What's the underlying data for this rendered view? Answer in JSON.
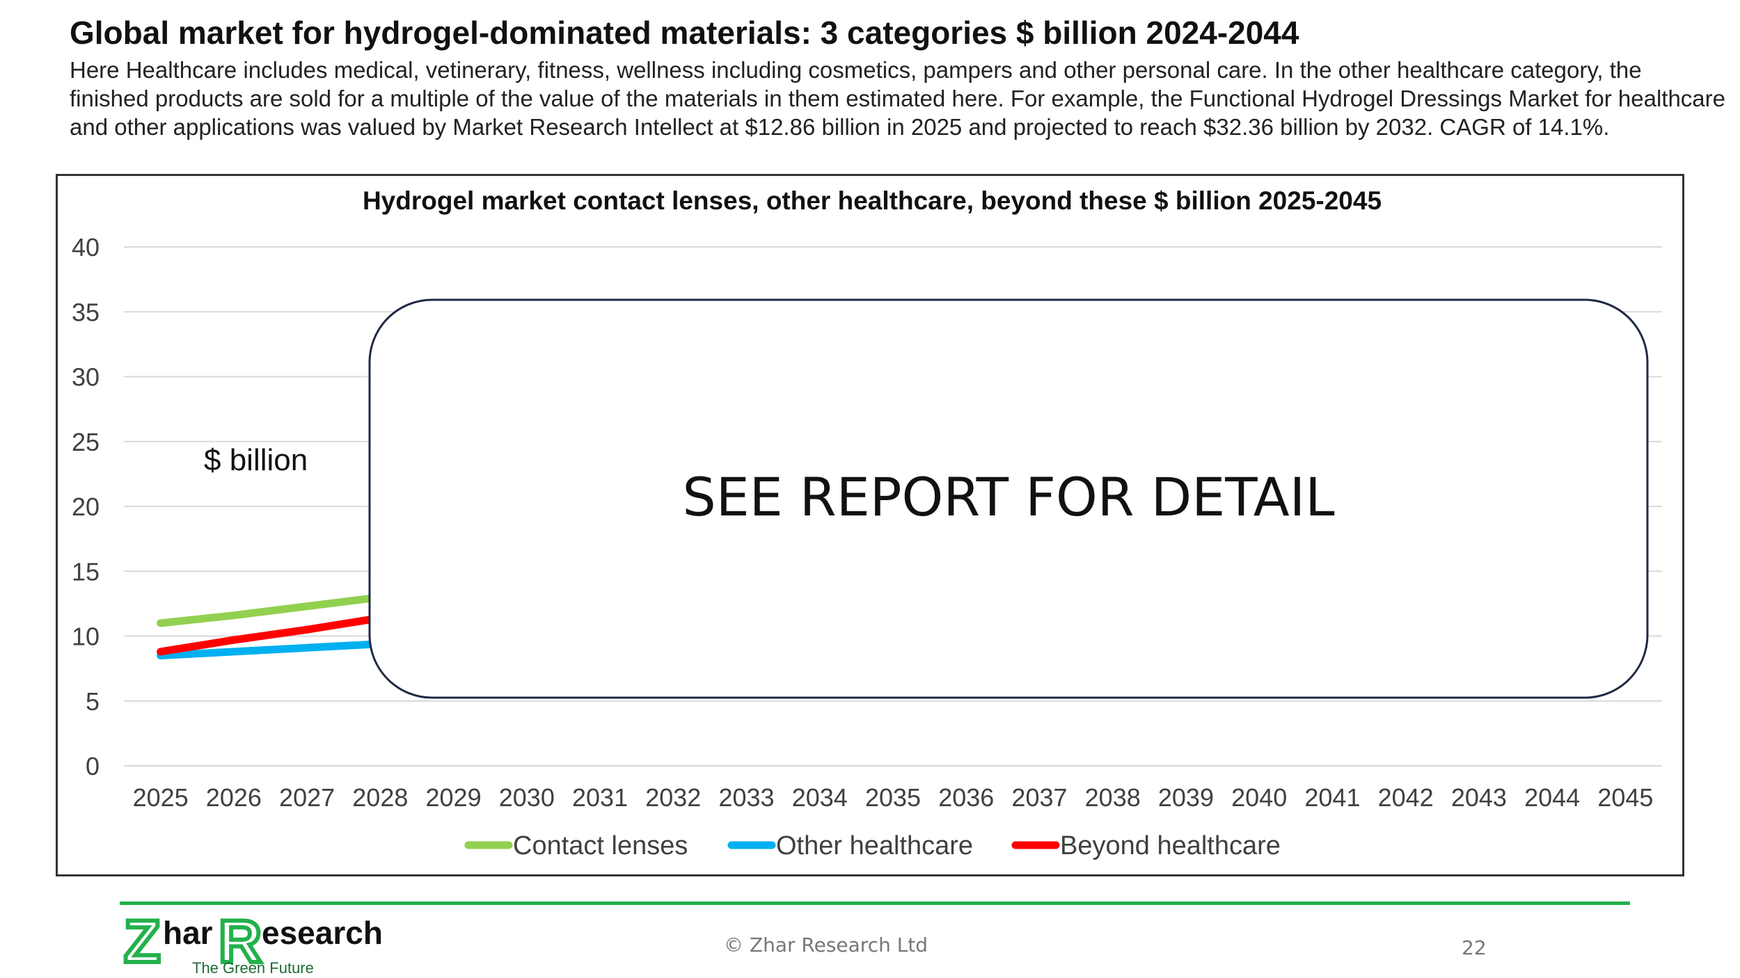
{
  "slide": {
    "title": "Global market for hydrogel-dominated materials: 3 categories $ billion 2024-2044",
    "description": "Here Healthcare includes medical, vetinerary, fitness, wellness including cosmetics, pampers and other personal care. In the other healthcare category, the finished products are sold for a multiple of the value of the materials in them estimated here. For example, the Functional Hydrogel Dressings Market  for healthcare and other applications was valued by Market Research Intellect at  $12.86 billion in 2025 and projected to reach $32.36 billion by 2032. CAGR of 14.1%."
  },
  "chart_data": {
    "type": "line",
    "title": "Hydrogel market contact lenses, other healthcare, beyond these $ billion 2025-2045",
    "ylabel": "$ billion",
    "xlabel": "",
    "ylim": [
      0,
      40
    ],
    "yticks": [
      0,
      5,
      10,
      15,
      20,
      25,
      30,
      35,
      40
    ],
    "grid": true,
    "legend": "bottom",
    "categories": [
      "2025",
      "2026",
      "2027",
      "2028",
      "2029",
      "2030",
      "2031",
      "2032",
      "2033",
      "2034",
      "2035",
      "2036",
      "2037",
      "2038",
      "2039",
      "2040",
      "2041",
      "2042",
      "2043",
      "2044",
      "2045"
    ],
    "series": [
      {
        "name": "Contact lenses",
        "color": "#92d050",
        "values": [
          11,
          11.6,
          12.3,
          13
        ]
      },
      {
        "name": "Other healthcare",
        "color": "#00b0f0",
        "values": [
          8.5,
          8.8,
          9.1,
          9.4
        ]
      },
      {
        "name": "Beyond healthcare",
        "color": "#ff0000",
        "values": [
          8.8,
          9.7,
          10.5,
          11.4
        ]
      }
    ],
    "overlay_text": "SEE REPORT FOR DETAIL"
  },
  "footer": {
    "logo_z": "Z",
    "logo_har": "har",
    "logo_r": "R",
    "logo_esearch": "esearch",
    "logo_tagline": "The Green Future",
    "copyright": "© Zhar Research Ltd",
    "page_number": "22"
  }
}
